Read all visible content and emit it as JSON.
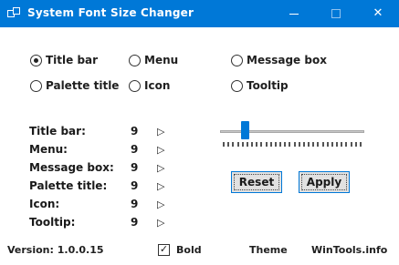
{
  "window": {
    "title": "System Font Size Changer",
    "accent": "#0078d7"
  },
  "radios": [
    {
      "label": "Title bar",
      "checked": true
    },
    {
      "label": "Menu",
      "checked": false
    },
    {
      "label": "Message box",
      "checked": false
    },
    {
      "label": "Palette title",
      "checked": false
    },
    {
      "label": "Icon",
      "checked": false
    },
    {
      "label": "Tooltip",
      "checked": false
    }
  ],
  "sizes": [
    {
      "label": "Title bar:",
      "value": "9",
      "arrow": "▷"
    },
    {
      "label": "Menu:",
      "value": "9",
      "arrow": "▷"
    },
    {
      "label": "Message box:",
      "value": "9",
      "arrow": "▷"
    },
    {
      "label": "Palette title:",
      "value": "9",
      "arrow": "▷"
    },
    {
      "label": "Icon:",
      "value": "9",
      "arrow": "▷"
    },
    {
      "label": "Tooltip:",
      "value": "9",
      "arrow": "▷"
    }
  ],
  "slider": {
    "fraction": 0.17
  },
  "buttons": {
    "reset": "Reset",
    "apply": "Apply"
  },
  "footer": {
    "version": "Version: 1.0.0.15",
    "bold_label": "Bold",
    "bold_checked": true,
    "theme": "Theme",
    "site": "WinTools.info"
  }
}
